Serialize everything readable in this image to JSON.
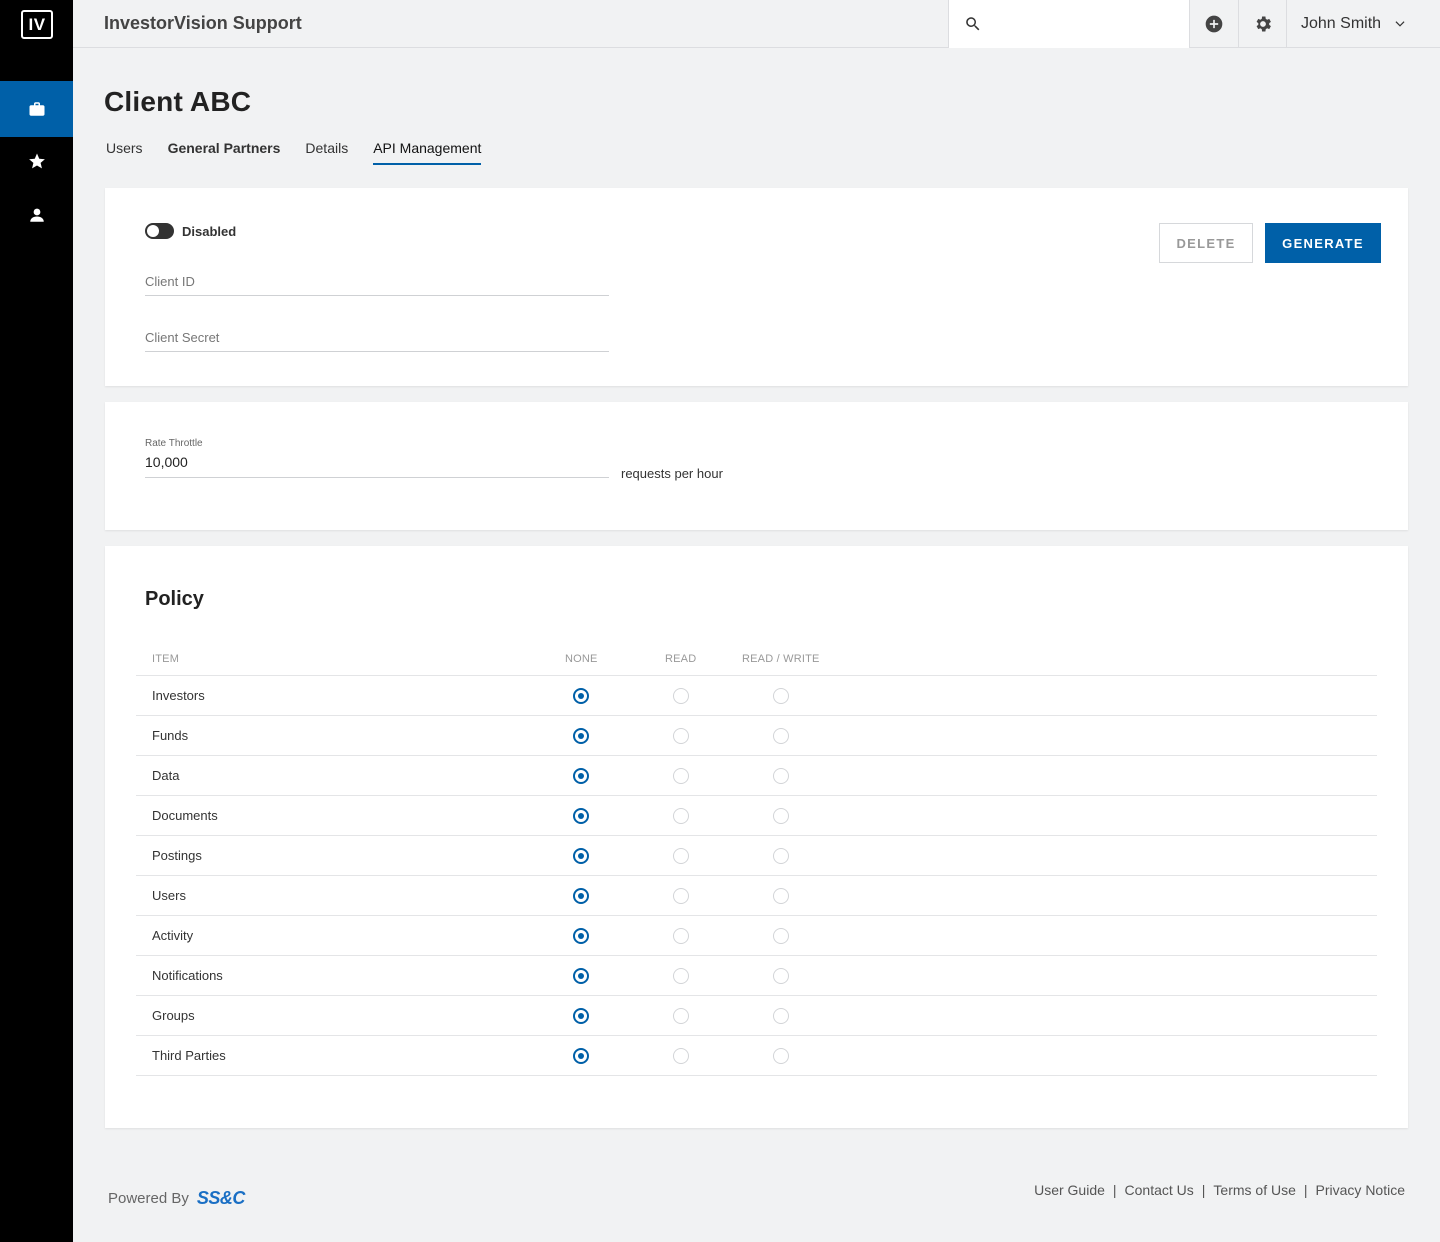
{
  "app": {
    "logo_text": "IV",
    "title": "InvestorVision Support"
  },
  "sidebar": {
    "items": [
      {
        "icon": "briefcase-icon",
        "active": true
      },
      {
        "icon": "star-icon",
        "active": false
      },
      {
        "icon": "person-icon",
        "active": false
      }
    ]
  },
  "topbar": {
    "search_placeholder": "",
    "user_name": "John Smith"
  },
  "page": {
    "title": "Client ABC",
    "tabs": [
      {
        "label": "Users",
        "active": false
      },
      {
        "label": "General Partners",
        "active": false
      },
      {
        "label": "Details",
        "active": false
      },
      {
        "label": "API Management",
        "active": true
      }
    ]
  },
  "credentials": {
    "toggle_label": "Disabled",
    "enabled": false,
    "client_id_placeholder": "Client ID",
    "client_secret_placeholder": "Client Secret",
    "delete_label": "DELETE",
    "generate_label": "GENERATE"
  },
  "rate": {
    "label": "Rate Throttle",
    "value": "10,000",
    "suffix": "requests per hour"
  },
  "policy": {
    "title": "Policy",
    "headers": {
      "item": "ITEM",
      "none": "NONE",
      "read": "READ",
      "rw": "READ / WRITE"
    },
    "rows": [
      {
        "name": "Investors",
        "selected": "none"
      },
      {
        "name": "Funds",
        "selected": "none"
      },
      {
        "name": "Data",
        "selected": "none"
      },
      {
        "name": "Documents",
        "selected": "none"
      },
      {
        "name": "Postings",
        "selected": "none"
      },
      {
        "name": "Users",
        "selected": "none"
      },
      {
        "name": "Activity",
        "selected": "none"
      },
      {
        "name": "Notifications",
        "selected": "none"
      },
      {
        "name": "Groups",
        "selected": "none"
      },
      {
        "name": "Third Parties",
        "selected": "none"
      }
    ]
  },
  "footer": {
    "powered_by": "Powered By",
    "brand": "SS&C",
    "links": [
      "User Guide",
      "Contact Us",
      "Terms of Use",
      "Privacy Notice"
    ]
  },
  "colors": {
    "accent": "#0060a8",
    "sidebar": "#000000",
    "background": "#f1f2f3"
  }
}
